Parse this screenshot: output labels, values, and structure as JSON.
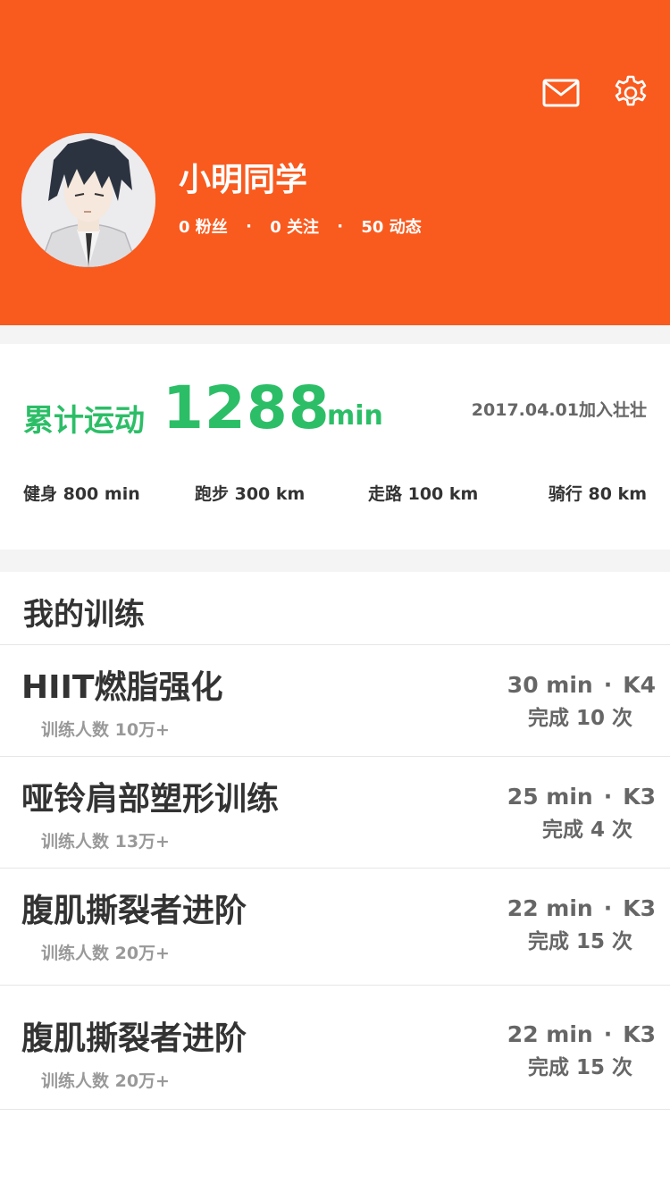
{
  "profile": {
    "name": "小明同学",
    "followers": "0 粉丝",
    "following": "0 关注",
    "posts": "50 动态",
    "separator": "·"
  },
  "stats": {
    "total_label": "累计运动",
    "total_value": "1288",
    "total_unit": "min",
    "joined": "2017.04.01加入壮壮",
    "breakdown": [
      "健身 800 min",
      "跑步 300 km",
      "走路 100 km",
      "骑行 80 km"
    ]
  },
  "trainings": {
    "title": "我的训练",
    "items": [
      {
        "name": "HIIT燃脂强化",
        "trainees": "训练人数 10万+",
        "duration": "30 min",
        "level": "K4",
        "completed": "完成 10 次"
      },
      {
        "name": "哑铃肩部塑形训练",
        "trainees": "训练人数 13万+",
        "duration": "25 min",
        "level": "K3",
        "completed": "完成 4 次"
      },
      {
        "name": "腹肌撕裂者进阶",
        "trainees": "训练人数 20万+",
        "duration": "22 min",
        "level": "K3",
        "completed": "完成 15 次"
      },
      {
        "name": "腹肌撕裂者进阶",
        "trainees": "训练人数 20万+",
        "duration": "22 min",
        "level": "K3",
        "completed": "完成 15 次"
      }
    ]
  },
  "icons": {
    "mail": "mail-icon",
    "settings": "gear-icon"
  },
  "colors": {
    "header": "#F95A1E",
    "accent": "#2CBE67"
  }
}
